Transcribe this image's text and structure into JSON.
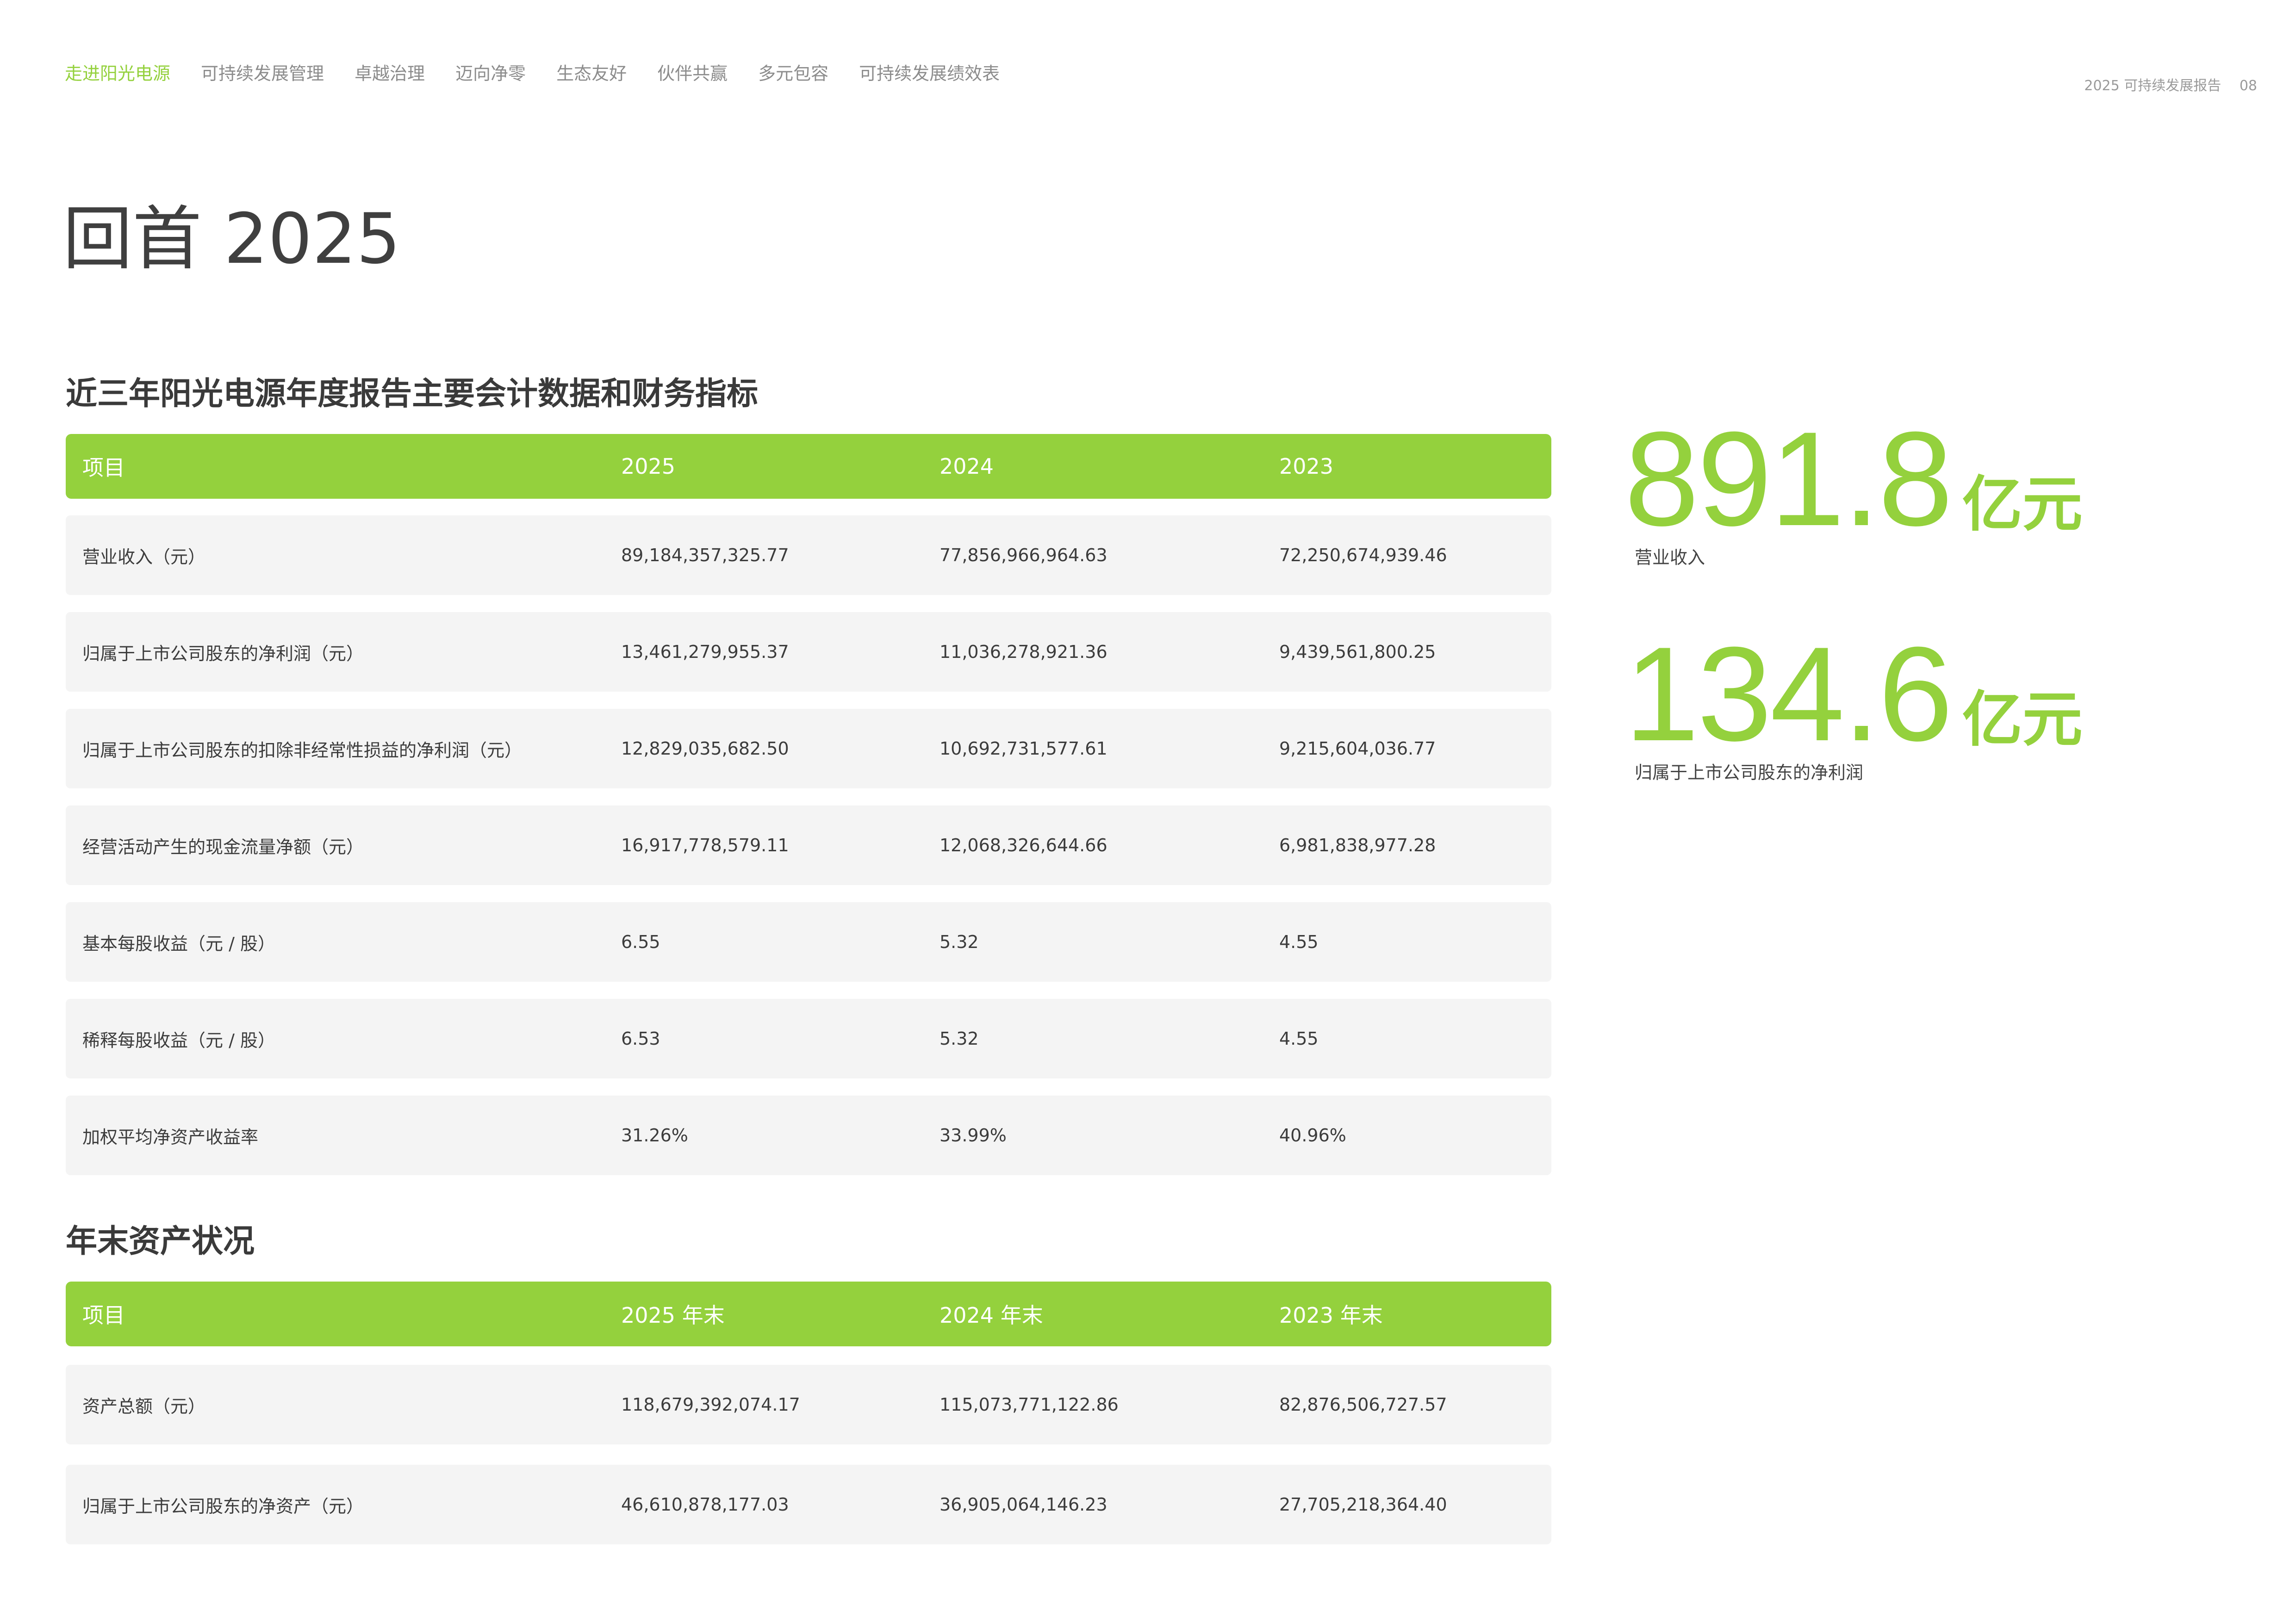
{
  "nav": {
    "items": [
      {
        "label": "走进阳光电源",
        "active": true
      },
      {
        "label": "可持续发展管理",
        "active": false
      },
      {
        "label": "卓越治理",
        "active": false
      },
      {
        "label": "迈向净零",
        "active": false
      },
      {
        "label": "生态友好",
        "active": false
      },
      {
        "label": "伙伴共赢",
        "active": false
      },
      {
        "label": "多元包容",
        "active": false
      },
      {
        "label": "可持续发展绩效表",
        "active": false
      }
    ]
  },
  "page_meta": {
    "report_name": "2025 可持续发展报告",
    "page_number": "08"
  },
  "page_title": "回首 2025",
  "financial_section": {
    "title": "近三年阳光电源年度报告主要会计数据和财务指标",
    "headers": [
      "项目",
      "2025",
      "2024",
      "2023"
    ],
    "rows": [
      [
        "营业收入（元）",
        "89,184,357,325.77",
        "77,856,966,964.63",
        "72,250,674,939.46"
      ],
      [
        "归属于上市公司股东的净利润（元）",
        "13,461,279,955.37",
        "11,036,278,921.36",
        "9,439,561,800.25"
      ],
      [
        "归属于上市公司股东的扣除非经常性损益的净利润（元）",
        "12,829,035,682.50",
        "10,692,731,577.61",
        "9,215,604,036.77"
      ],
      [
        "经营活动产生的现金流量净额（元）",
        "16,917,778,579.11",
        "12,068,326,644.66",
        "6,981,838,977.28"
      ],
      [
        "基本每股收益（元 / 股）",
        "6.55",
        "5.32",
        "4.55"
      ],
      [
        "稀释每股收益（元 / 股）",
        "6.53",
        "5.32",
        "4.55"
      ],
      [
        "加权平均净资产收益率",
        "31.26%",
        "33.99%",
        "40.96%"
      ]
    ]
  },
  "assets_section": {
    "title": "年末资产状况",
    "headers": [
      "项目",
      "2025 年末",
      "2024 年末",
      "2023 年末"
    ],
    "rows": [
      [
        "资产总额（元）",
        "118,679,392,074.17",
        "115,073,771,122.86",
        "82,876,506,727.57"
      ],
      [
        "归属于上市公司股东的净资产（元）",
        "46,610,878,177.03",
        "36,905,064,146.23",
        "27,705,218,364.40"
      ]
    ]
  },
  "highlights": [
    {
      "value": "891.8",
      "unit": "亿元",
      "caption": "营业收入"
    },
    {
      "value": "134.6",
      "unit": "亿元",
      "caption": "归属于上市公司股东的净利润"
    }
  ],
  "colors": {
    "accent": "#94d13d",
    "row_background": "#f4f4f4",
    "nav_text": "#8c8c8c",
    "title_text": "#3f3f3f"
  }
}
